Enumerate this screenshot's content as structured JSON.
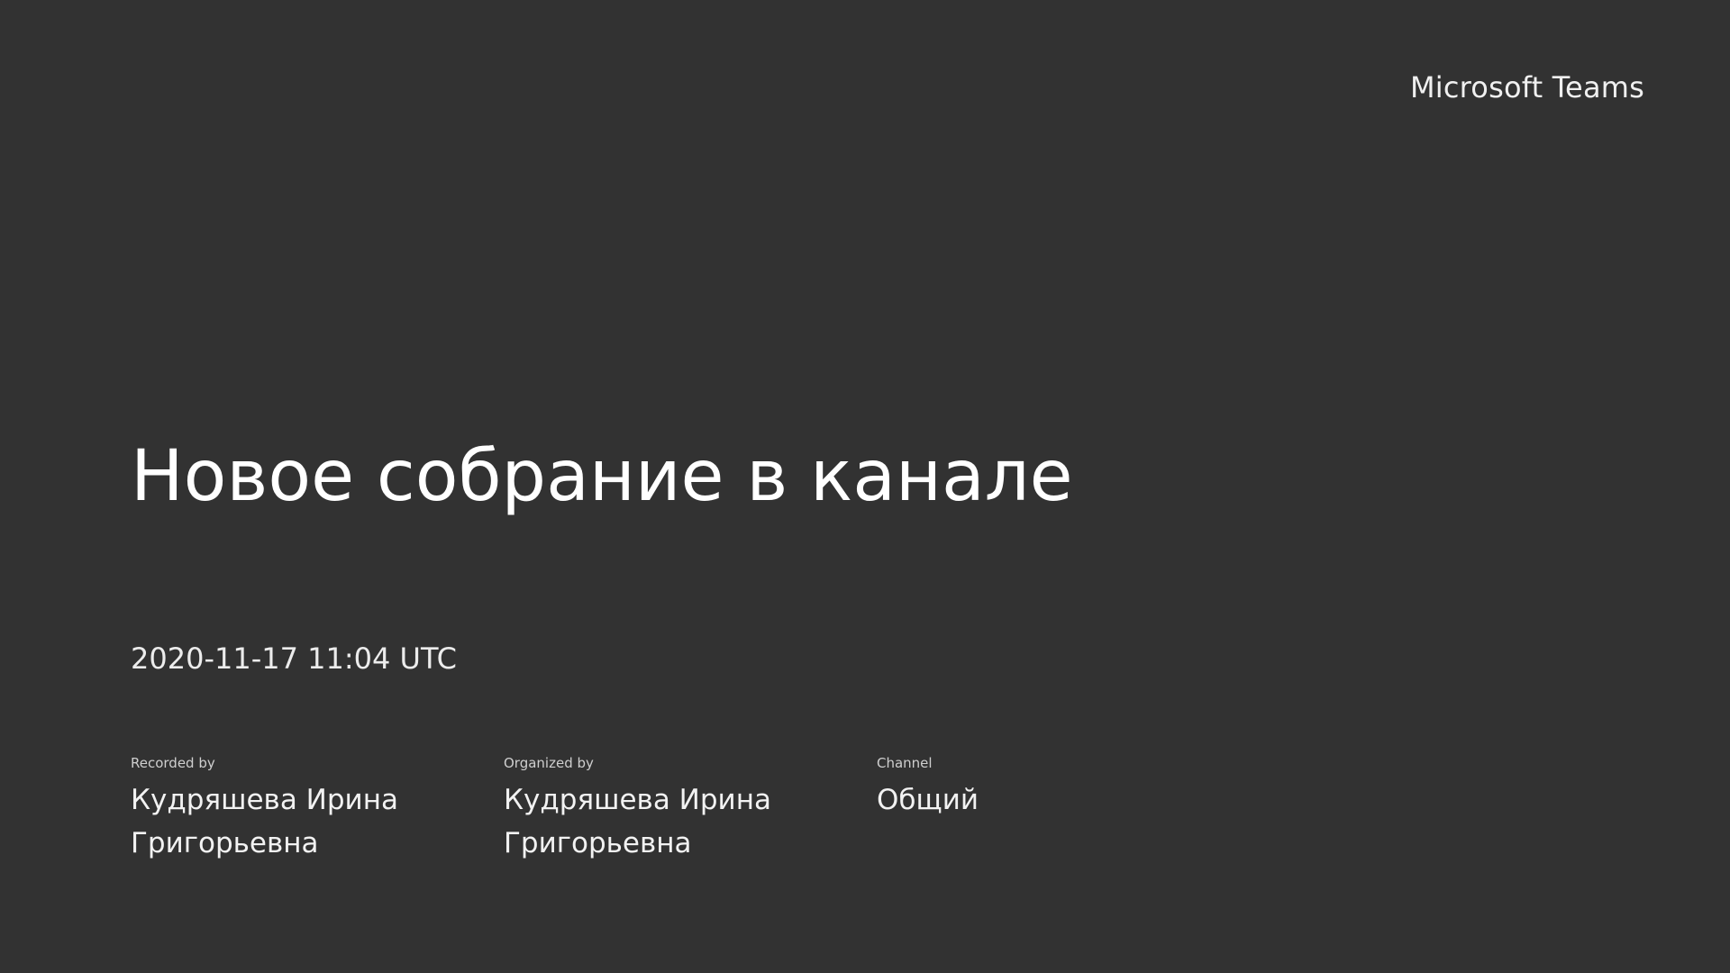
{
  "brand": "Microsoft Teams",
  "meeting": {
    "title": "Новое собрание в канале",
    "datetime": "2020-11-17 11:04 UTC"
  },
  "details": [
    {
      "label": "Recorded by",
      "value": "Кудряшева Ирина Григорьевна"
    },
    {
      "label": "Organized by",
      "value": "Кудряшева Ирина Григорьевна"
    },
    {
      "label": "Channel",
      "value": "Общий"
    }
  ],
  "colors": {
    "background": "#323232",
    "text": "#ffffff"
  }
}
